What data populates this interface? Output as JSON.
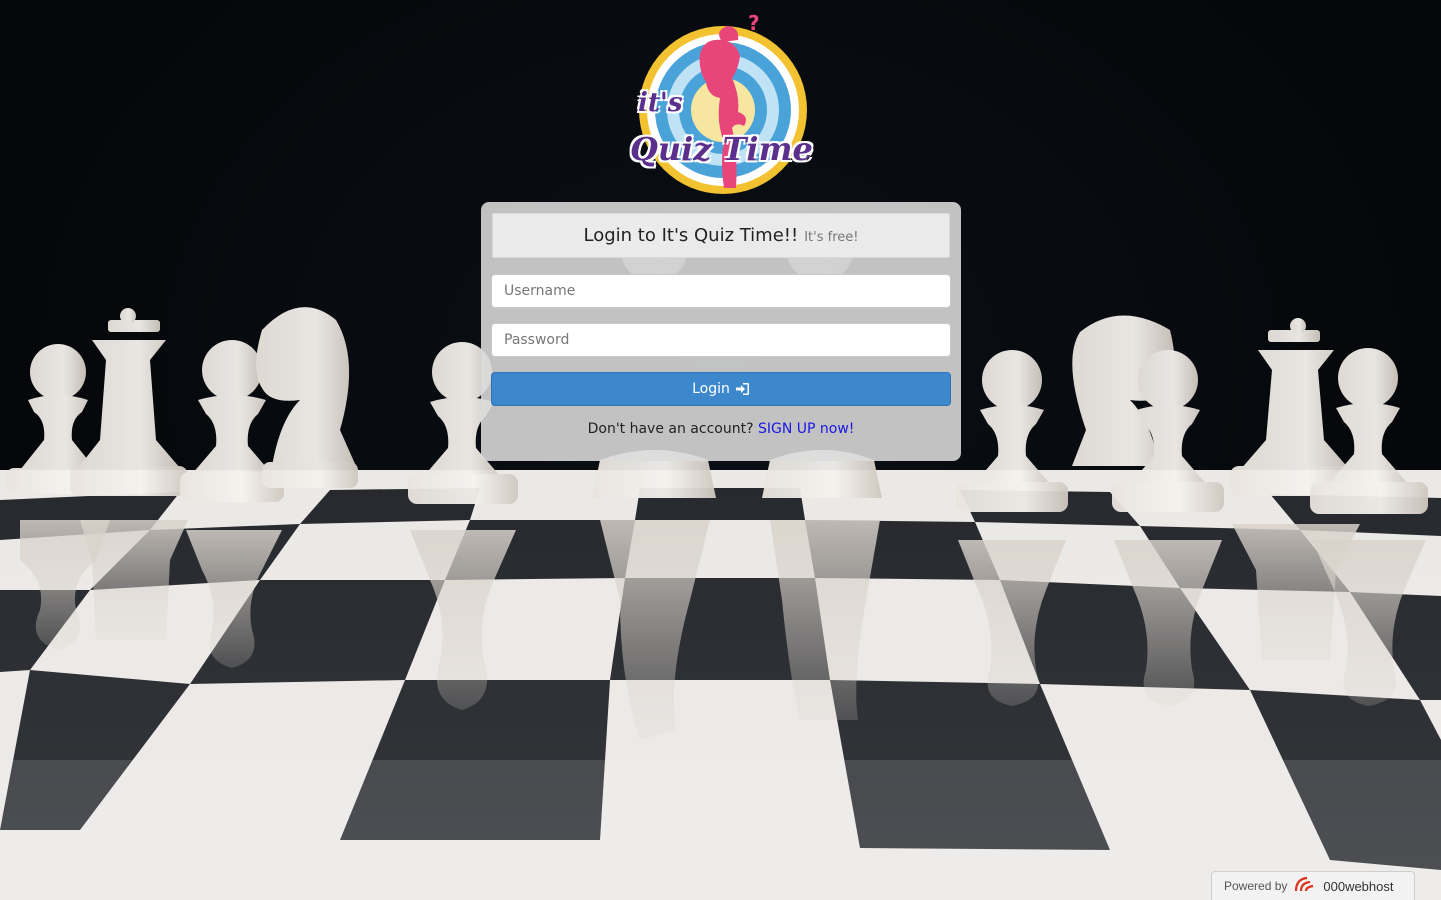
{
  "logo": {
    "line1": "it's",
    "line2": "Quiz Time"
  },
  "login": {
    "title": "Login to It's Quiz Time!!",
    "subtitle": "It's free!",
    "username_placeholder": "Username",
    "password_placeholder": "Password",
    "button_label": "Login",
    "signup_prompt": "Don't have an account?",
    "signup_link": "SIGN UP now!"
  },
  "footer": {
    "powered_by": "Powered by",
    "host_name": "000webhost"
  },
  "colors": {
    "button": "#3d87cc",
    "link": "#1a17e6",
    "logo_ring_outer": "#f2c230",
    "logo_ring_blue": "#4aa3d8",
    "logo_figure": "#e8457a",
    "logo_text": "#5b2f8c"
  },
  "icons": {
    "login": "sign-in-icon",
    "host": "000webhost-logo-icon"
  }
}
